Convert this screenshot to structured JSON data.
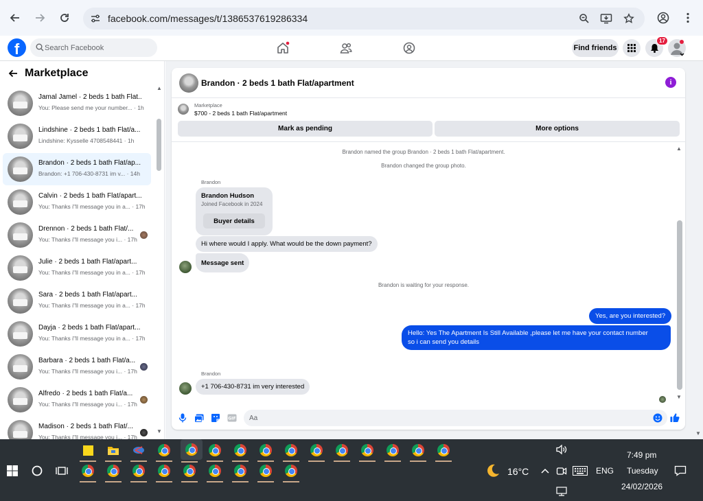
{
  "browser": {
    "url": "facebook.com/messages/t/1386537619286334"
  },
  "fb": {
    "search_placeholder": "Search Facebook",
    "find_friends": "Find friends",
    "notif_count": "17"
  },
  "sidebar": {
    "title": "Marketplace",
    "conversations": [
      {
        "title": "Jamal Jamel · 2 beds 1 bath Flat...",
        "preview": "You: Please send me your number... · 1h",
        "active": false
      },
      {
        "title": "Lindshine · 2 beds 1 bath Flat/a...",
        "preview": "Lindshine: Kysselle 4708548441 · 1h",
        "active": false
      },
      {
        "title": "Brandon · 2 beds 1 bath Flat/ap...",
        "preview": "Brandon: +1 706-430-8731 im v... · 14h",
        "active": true
      },
      {
        "title": "Calvin · 2 beds 1 bath Flat/apart...",
        "preview": "You: Thanks i\"ll message you in a... · 17h",
        "active": false
      },
      {
        "title": "Drennon · 2 beds 1 bath Flat/...",
        "preview": "You: Thanks i\"ll message you i... · 17h",
        "active": false
      },
      {
        "title": "Julie · 2 beds 1 bath Flat/apart...",
        "preview": "You: Thanks i\"ll message you in a... · 17h",
        "active": false
      },
      {
        "title": "Sara · 2 beds 1 bath Flat/apart...",
        "preview": "You: Thanks i\"ll message you in a... · 17h",
        "active": false
      },
      {
        "title": "Dayja · 2 beds 1 bath Flat/apart...",
        "preview": "You: Thanks i\"ll message you in a... · 17h",
        "active": false
      },
      {
        "title": "Barbara · 2 beds 1 bath Flat/a...",
        "preview": "You: Thanks i\"ll message you i... · 17h",
        "active": false
      },
      {
        "title": "Alfredo · 2 beds 1 bath Flat/a...",
        "preview": "You: Thanks i\"ll message you i... · 17h",
        "active": false
      },
      {
        "title": "Madison · 2 beds 1 bath Flat/...",
        "preview": "You: Thanks i\"ll message you i... · 17h",
        "active": false
      }
    ]
  },
  "chat": {
    "title": "Brandon · 2 beds 1 bath Flat/apartment",
    "marketplace_label": "Marketplace",
    "listing": "$700 - 2 beds 1 bath Flat/apartment",
    "mark_pending": "Mark as pending",
    "more_options": "More options",
    "system_1": "Brandon named the group Brandon · 2 beds 1 bath Flat/apartment.",
    "system_2": "Brandon changed the group photo.",
    "sender_name": "Brandon",
    "card_name": "Brandon Hudson",
    "card_joined": "Joined Facebook in 2024",
    "card_button": "Buyer details",
    "msg_in_1": "Hi where would I apply. What would be the down payment?",
    "msg_in_2": "Message sent",
    "system_3": "Brandon is waiting for your response.",
    "msg_out_1": "Yes, are you interested?",
    "msg_out_2_line1": "Hello: Yes The Apartment Is Still Available ,please let me have your contact number",
    "msg_out_2_line2": "so i can send you details",
    "msg_in_3": "+1 706-430-8731 im very interested",
    "composer_placeholder": "Aa"
  },
  "taskbar": {
    "weather": "16°C",
    "lang": "ENG",
    "time": "7:49 pm",
    "day": "Tuesday",
    "date": "24/02/2026"
  },
  "colors": {
    "fb_blue": "#0866ff",
    "outgoing_bubble": "#0a4ee8",
    "info_purple": "#8e1dd6",
    "badge_red": "#e41e3f"
  }
}
